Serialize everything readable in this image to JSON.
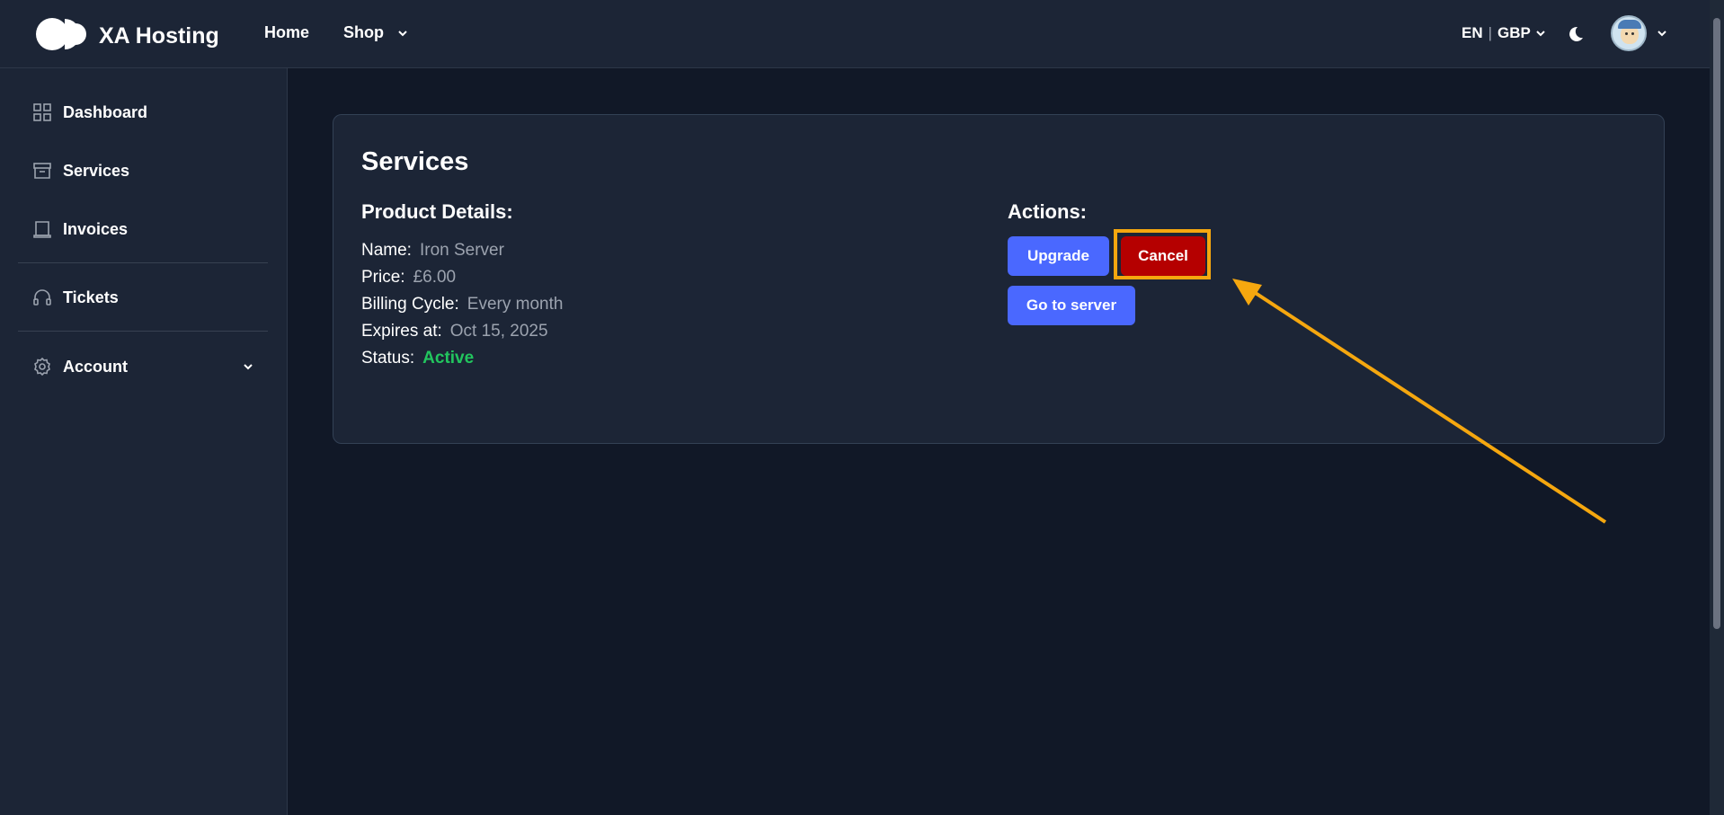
{
  "header": {
    "brand": "XA Hosting",
    "nav": {
      "home": "Home",
      "shop": "Shop"
    },
    "locale": {
      "lang": "EN",
      "separator": "|",
      "currency": "GBP"
    },
    "icons": [
      "logo-icon",
      "chevron-down-icon",
      "moon-icon",
      "avatar"
    ]
  },
  "sidebar": {
    "items": [
      {
        "label": "Dashboard",
        "icon": "grid-icon"
      },
      {
        "label": "Services",
        "icon": "archive-box-icon"
      },
      {
        "label": "Invoices",
        "icon": "receipt-icon"
      },
      {
        "label": "Tickets",
        "icon": "headset-icon"
      },
      {
        "label": "Account",
        "icon": "gear-icon"
      }
    ]
  },
  "card": {
    "title": "Services",
    "product_details_title": "Product Details:",
    "details": {
      "name_label": "Name:",
      "name_value": "Iron Server",
      "price_label": "Price:",
      "price_value": "£6.00",
      "billing_label": "Billing Cycle:",
      "billing_value": "Every month",
      "expires_label": "Expires at:",
      "expires_value": "Oct 15, 2025",
      "status_label": "Status:",
      "status_value": "Active"
    },
    "actions_title": "Actions:",
    "buttons": {
      "upgrade": "Upgrade",
      "cancel": "Cancel",
      "goto": "Go to server"
    }
  },
  "colors": {
    "background": "#111827",
    "panel": "#1c2536",
    "primary_button": "#4a68ff",
    "cancel_button": "#b50000",
    "status_active": "#22c55e",
    "annotation": "#f5a70f"
  }
}
